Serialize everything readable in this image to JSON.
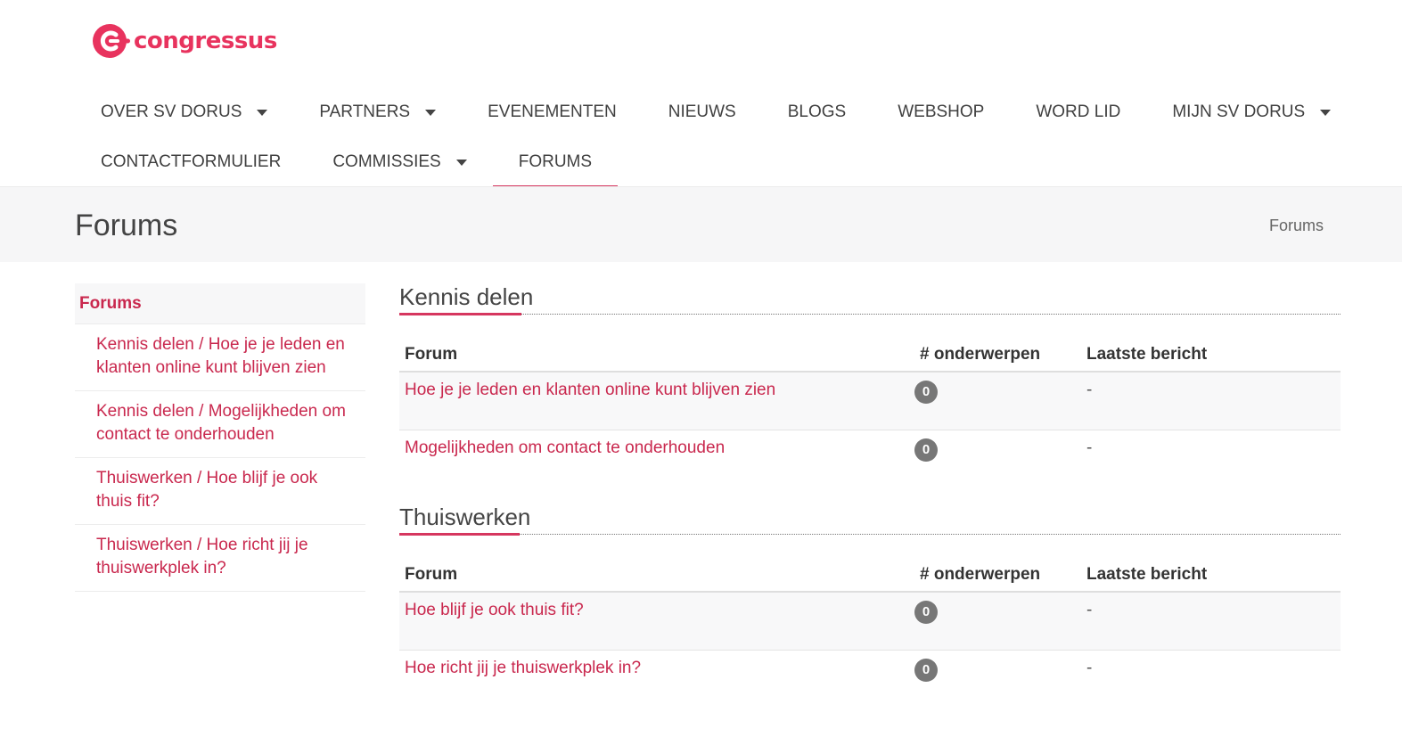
{
  "brand": {
    "name": "congressus",
    "accent": "#e8335e"
  },
  "nav": {
    "row1": [
      {
        "label": "OVER SV DORUS",
        "dropdown": true
      },
      {
        "label": "PARTNERS",
        "dropdown": true
      },
      {
        "label": "EVENEMENTEN",
        "dropdown": false
      },
      {
        "label": "NIEUWS",
        "dropdown": false
      },
      {
        "label": "BLOGS",
        "dropdown": false
      },
      {
        "label": "WEBSHOP",
        "dropdown": false
      },
      {
        "label": "WORD LID",
        "dropdown": false
      },
      {
        "label": "MIJN SV DORUS",
        "dropdown": true
      }
    ],
    "row2": [
      {
        "label": "CONTACTFORMULIER",
        "dropdown": false
      },
      {
        "label": "COMMISSIES",
        "dropdown": true
      },
      {
        "label": "FORUMS",
        "dropdown": false,
        "active": true
      }
    ]
  },
  "page": {
    "title": "Forums",
    "breadcrumb": "Forums"
  },
  "sidebar": {
    "heading": "Forums",
    "items": [
      "Kennis delen / Hoe je je leden en klanten online kunt blijven zien",
      "Kennis delen / Mogelijkheden om contact te onderhouden",
      "Thuiswerken / Hoe blijf je ook thuis fit?",
      "Thuiswerken / Hoe richt jij je thuiswerkplek in?"
    ]
  },
  "sections": [
    {
      "title": "Kennis delen",
      "headers": {
        "forum": "Forum",
        "count": "# onderwerpen",
        "last": "Laatste bericht"
      },
      "rows": [
        {
          "forum": "Hoe je je leden en klanten online kunt blijven zien",
          "count": "0",
          "last": "-"
        },
        {
          "forum": "Mogelijkheden om contact te onderhouden",
          "count": "0",
          "last": "-"
        }
      ]
    },
    {
      "title": "Thuiswerken",
      "headers": {
        "forum": "Forum",
        "count": "# onderwerpen",
        "last": "Laatste bericht"
      },
      "rows": [
        {
          "forum": "Hoe blijf je ook thuis fit?",
          "count": "0",
          "last": "-"
        },
        {
          "forum": "Hoe richt jij je thuiswerkplek in?",
          "count": "0",
          "last": "-"
        }
      ]
    }
  ]
}
